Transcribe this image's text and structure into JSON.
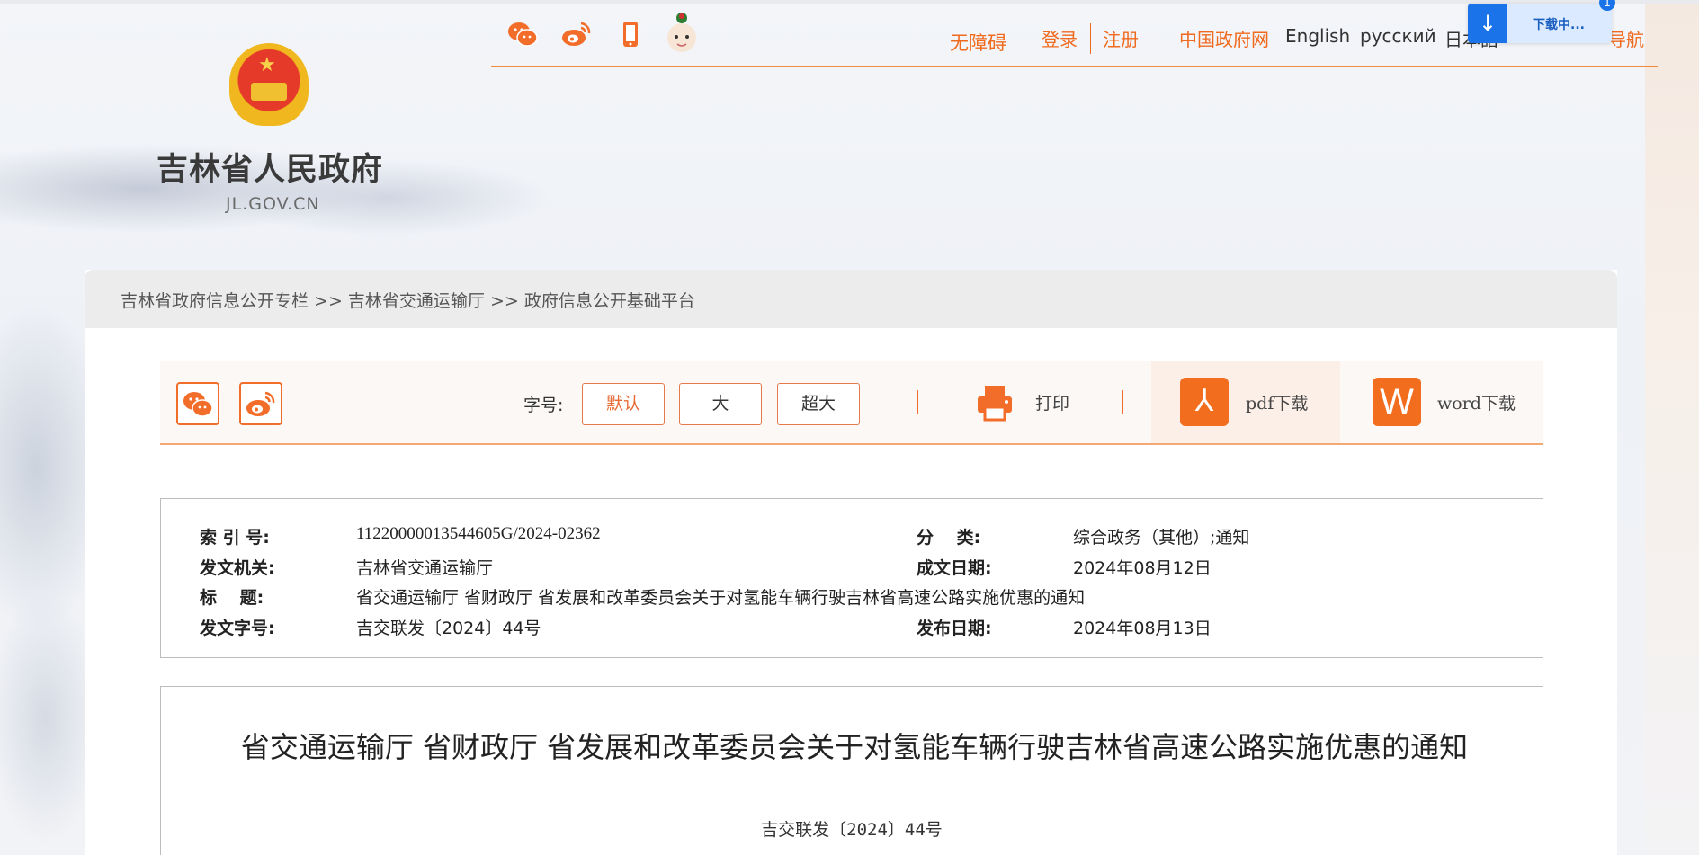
{
  "site": {
    "name": "吉林省人民政府",
    "domain": "JL.GOV.CN"
  },
  "header_icons": [
    "wechat-icon",
    "weibo-icon",
    "mobile-icon",
    "mascot-icon"
  ],
  "nav": {
    "accessibility": "无障碍",
    "login": "登录",
    "register": "注册",
    "gov_cn": "中国政府网",
    "english": "English",
    "russian": "русский",
    "japanese": "日本語",
    "nav_partial": "导航"
  },
  "download_popup": {
    "text": "下载中...",
    "count": "1"
  },
  "breadcrumb": "吉林省政府信息公开专栏 >> 吉林省交通运输厅 >> 政府信息公开基础平台",
  "toolbar": {
    "font_size_label": "字号:",
    "font_default": "默认",
    "font_large": "大",
    "font_xlarge": "超大",
    "print": "打印",
    "pdf_download": "pdf下载",
    "word_download": "word下载",
    "pdf_icon_glyph": "⅄",
    "word_icon_glyph": "W"
  },
  "info": {
    "index_key": "索 引 号:",
    "index_val": "11220000013544605G/2024-02362",
    "category_key": "分　 类:",
    "category_val": "综合政务（其他）;通知",
    "issuer_key": "发文机关:",
    "issuer_val": "吉林省交通运输厅",
    "written_date_key": "成文日期:",
    "written_date_val": "2024年08月12日",
    "title_key": "标　 题:",
    "title_val": "省交通运输厅 省财政厅 省发展和改革委员会关于对氢能车辆行驶吉林省高速公路实施优惠的通知",
    "doc_no_key": "发文字号:",
    "doc_no_val": "吉交联发〔2024〕44号",
    "publish_date_key": "发布日期:",
    "publish_date_val": "2024年08月13日"
  },
  "article": {
    "title": "省交通运输厅  省财政厅  省发展和改革委员会关于对氢能车辆行驶吉林省高速公路实施优惠的通知",
    "doc_no": "吉交联发〔2024〕44号"
  },
  "colors": {
    "accent": "#f26d2a",
    "link_orange": "#f06a1e"
  }
}
